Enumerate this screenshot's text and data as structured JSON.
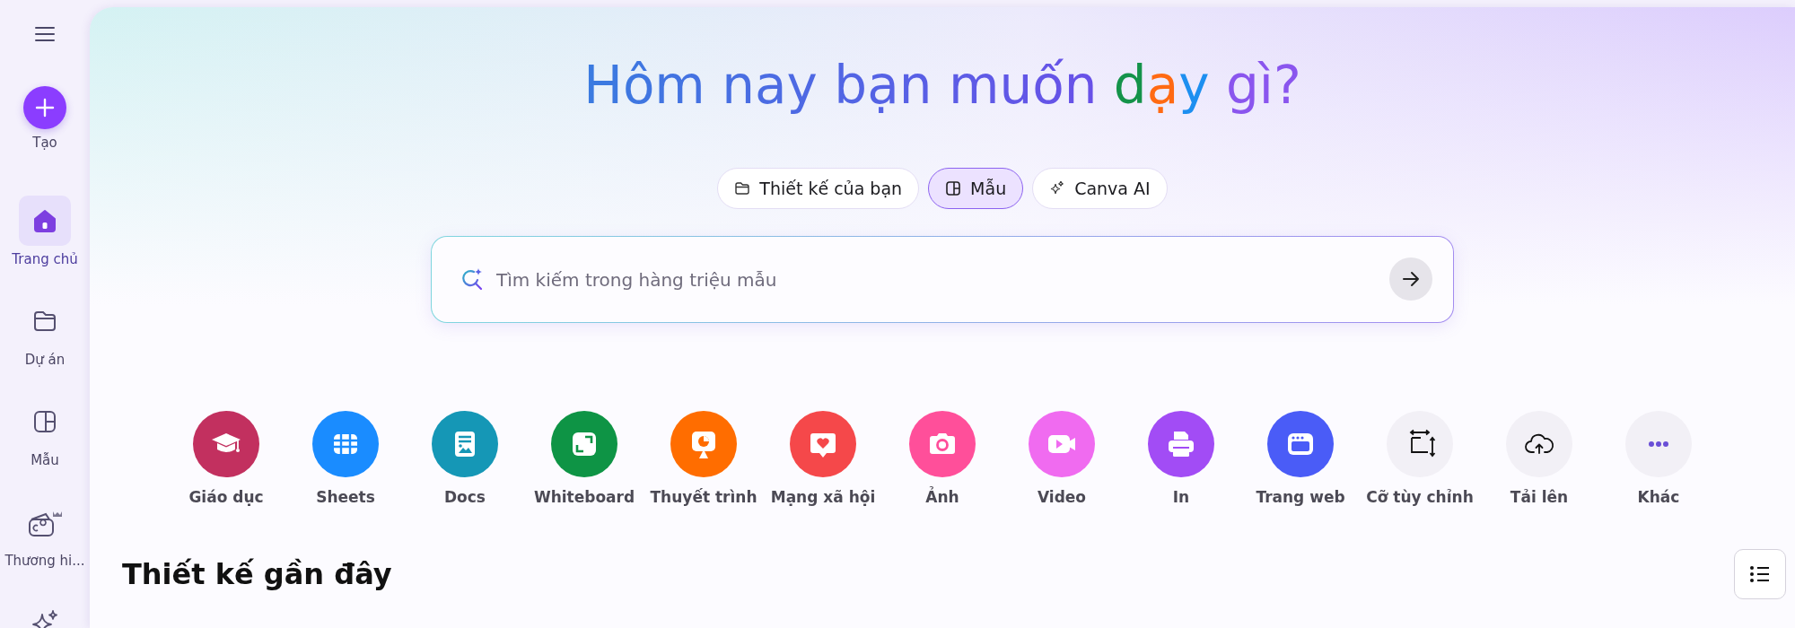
{
  "sidebar": {
    "items": [
      {
        "label": "Tạo",
        "kind": "create",
        "selected": false
      },
      {
        "label": "Trang chủ",
        "kind": "home",
        "selected": true
      },
      {
        "label": "Dự án",
        "kind": "projects",
        "selected": false
      },
      {
        "label": "Mẫu",
        "kind": "templates",
        "selected": false
      },
      {
        "label": "Thương hi...",
        "kind": "brand",
        "selected": false
      },
      {
        "kind": "magic",
        "selected": false
      }
    ]
  },
  "heading": [
    {
      "text": "Hôm nay bạn muốn ",
      "kind": "gradient"
    },
    {
      "text": "d",
      "kind": "solid",
      "color": "#14934a"
    },
    {
      "text": "ạ",
      "kind": "solid",
      "color": "#ff6a13"
    },
    {
      "text": "y",
      "kind": "solid",
      "color": "#1d8ff0"
    },
    {
      "text": " gì?",
      "kind": "solid",
      "color": "#8a55ee"
    }
  ],
  "tabs": [
    {
      "label": "Thiết kế của bạn",
      "kind": "folder",
      "selected": false
    },
    {
      "label": "Mẫu",
      "kind": "templates",
      "selected": true
    },
    {
      "label": "Canva AI",
      "kind": "sparkle",
      "selected": false
    }
  ],
  "search": {
    "placeholder": "Tìm kiếm trong hàng triệu mẫu"
  },
  "categories": [
    {
      "label": "Giáo dục",
      "kind": "education",
      "color": "#c2305f"
    },
    {
      "label": "Sheets",
      "kind": "sheets",
      "color": "#1a8cff"
    },
    {
      "label": "Docs",
      "kind": "docs",
      "color": "#1597b6"
    },
    {
      "label": "Whiteboard",
      "kind": "whiteboard",
      "color": "#0e9445"
    },
    {
      "label": "Thuyết trình",
      "kind": "presentation",
      "color": "#ff6d00"
    },
    {
      "label": "Mạng xã hội",
      "kind": "social",
      "color": "#f5484a"
    },
    {
      "label": "Ảnh",
      "kind": "photo",
      "color": "#ff4f9a"
    },
    {
      "label": "Video",
      "kind": "video",
      "color": "#f06bf0"
    },
    {
      "label": "In",
      "kind": "print",
      "color": "#a24cf5"
    },
    {
      "label": "Trang web",
      "kind": "website",
      "color": "#4a5cf7"
    },
    {
      "label": "Cỡ tùy chỉnh",
      "kind": "resize",
      "color": "#f2f0f6"
    },
    {
      "label": "Tải lên",
      "kind": "upload",
      "color": "#f2f0f6"
    },
    {
      "label": "Khác",
      "kind": "more",
      "color": "#f2f0f6"
    }
  ],
  "recent": {
    "title": "Thiết kế gần đây"
  }
}
